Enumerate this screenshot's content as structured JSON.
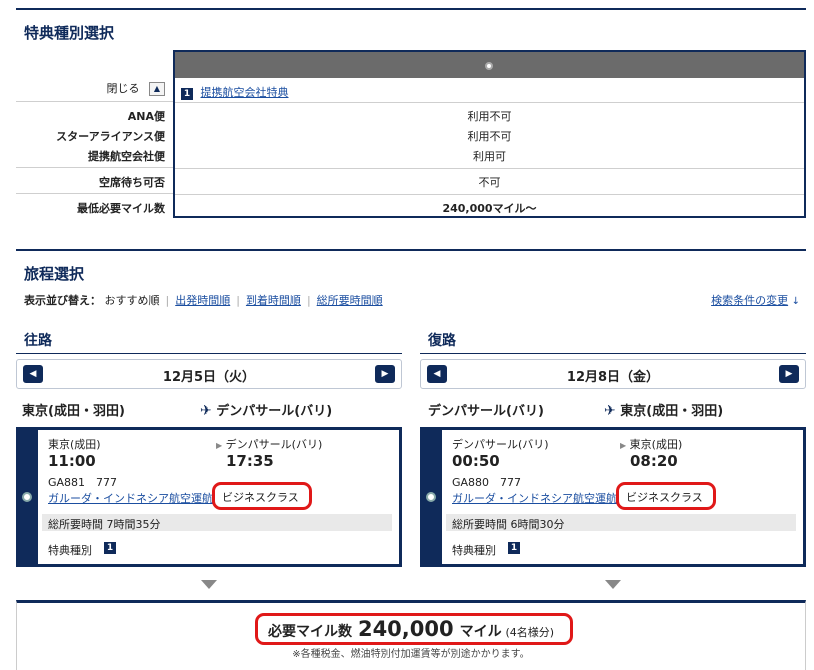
{
  "award": {
    "title": "特典種別選択",
    "close_label": "閉じる",
    "close_icon": "▲",
    "option_num": "1",
    "option_label": "提携航空会社特典",
    "rows": [
      {
        "label": "ANA便",
        "value": "利用不可"
      },
      {
        "label": "スターアライアンス便",
        "value": "利用不可"
      },
      {
        "label": "提携航空会社便",
        "value": "利用可"
      },
      {
        "label": "空席待ち可否",
        "value": "不可"
      },
      {
        "label": "最低必要マイル数",
        "value": "240,000マイル～"
      }
    ]
  },
  "itinerary": {
    "title": "旅程選択",
    "sort_label": "表示並び替え：",
    "sort_current": "おすすめ順",
    "sort_options": [
      "出発時間順",
      "到着時間順",
      "総所要時間順"
    ],
    "change_link": "検索条件の変更",
    "change_icon": "↓",
    "outbound": {
      "title": "往路",
      "prev": "◀",
      "next": "▶",
      "date": "12月5日（火）",
      "from": "東京(成田・羽田)",
      "to": "デンパサール(バリ)",
      "dep_place": "東京(成田)",
      "dep_time": "11:00",
      "arr_place": "デンパサール(バリ)",
      "arr_time": "17:35",
      "flight": "GA881　777",
      "airline": "ガルーダ・インドネシア航空運航",
      "cabin": "ビジネスクラス",
      "duration": "総所要時間 7時間35分",
      "award_type_label": "特典種別",
      "award_type_num": "1"
    },
    "return": {
      "title": "復路",
      "prev": "◀",
      "next": "▶",
      "date": "12月8日（金）",
      "from": "デンパサール(バリ)",
      "to": "東京(成田・羽田)",
      "dep_place": "デンパサール(バリ)",
      "dep_time": "00:50",
      "arr_place": "東京(成田)",
      "arr_time": "08:20",
      "flight": "GA880　777",
      "airline": "ガルーダ・インドネシア航空運航",
      "cabin": "ビジネスクラス",
      "duration": "総所要時間 6時間30分",
      "award_type_label": "特典種別",
      "award_type_num": "1"
    }
  },
  "total": {
    "label": "必要マイル数",
    "miles": "240,000",
    "unit": "マイル",
    "pax": "(4名様分)",
    "note": "※各種税金、燃油特別付加運賃等が別途かかります。"
  },
  "colors": {
    "navy": "#0f2a5a",
    "highlight": "#e01818",
    "link": "#1b4ea0"
  }
}
